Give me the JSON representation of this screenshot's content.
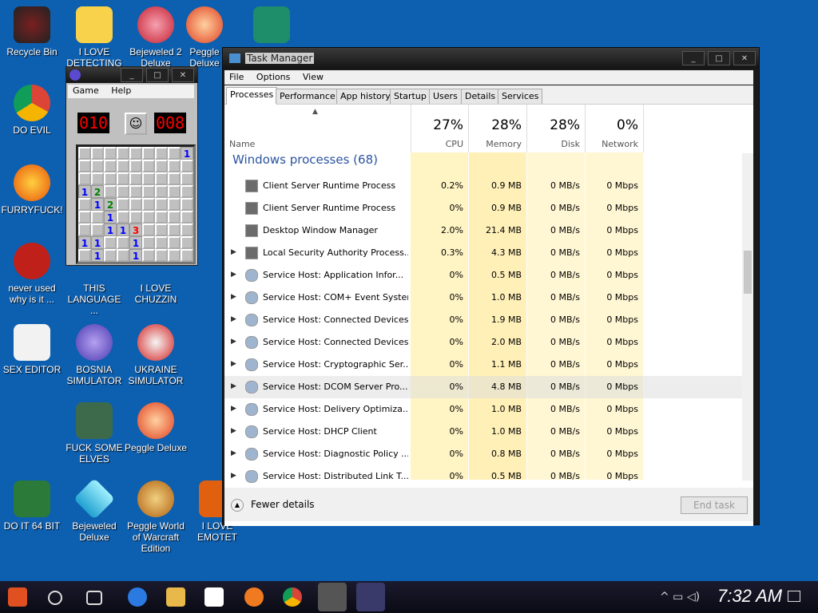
{
  "desktop": {
    "icons": [
      {
        "label": "Recycle Bin"
      },
      {
        "label": "I LOVE DETECTING"
      },
      {
        "label": "Bejeweled 2 Deluxe"
      },
      {
        "label": "Peggle Deluxe"
      },
      {
        "label": "DO EVIL"
      },
      {
        "label": "FURRYFUCK!"
      },
      {
        "label": "never used why is it ..."
      },
      {
        "label": "THIS LANGUAGE ..."
      },
      {
        "label": "I LOVE CHUZZIN"
      },
      {
        "label": "SEX EDITOR"
      },
      {
        "label": "BOSNIA SIMULATOR"
      },
      {
        "label": "UKRAINE SIMULATOR"
      },
      {
        "label": "FUCK SOME ELVES"
      },
      {
        "label": "Peggle Deluxe"
      },
      {
        "label": "DO IT 64 BIT"
      },
      {
        "label": "Bejeweled Deluxe"
      },
      {
        "label": "Peggle World of Warcraft Edition"
      },
      {
        "label": "I LOVE EMOTET"
      }
    ]
  },
  "minesweeper": {
    "menu": [
      "Game",
      "Help"
    ],
    "mines_counter": "010",
    "timer": "008",
    "face": "☺",
    "grid": [
      [
        "",
        "",
        "",
        "",
        "",
        "",
        "",
        "",
        "1"
      ],
      [
        "",
        "",
        "",
        "",
        "",
        "",
        "",
        "",
        ""
      ],
      [
        "",
        "",
        "",
        "",
        "",
        "",
        "",
        "",
        ""
      ],
      [
        "1",
        "2",
        "",
        "",
        "",
        "",
        "",
        "",
        ""
      ],
      [
        "",
        "1",
        "2",
        "",
        "",
        "",
        "",
        "",
        ""
      ],
      [
        "",
        "",
        "1",
        "",
        "",
        "",
        "",
        "",
        ""
      ],
      [
        "",
        "",
        "1",
        "1",
        "3",
        "",
        "",
        "",
        ""
      ],
      [
        "1",
        "1",
        "",
        "",
        "1",
        "",
        "",
        "",
        ""
      ],
      [
        "",
        "1",
        "",
        "",
        "1",
        "",
        "",
        "",
        ""
      ]
    ]
  },
  "taskmanager": {
    "title": "Task Manager",
    "menu": [
      "File",
      "Options",
      "View"
    ],
    "tabs": [
      "Processes",
      "Performance",
      "App history",
      "Startup",
      "Users",
      "Details",
      "Services"
    ],
    "columns": {
      "name": "Name",
      "cpu": {
        "pct": "27%",
        "label": "CPU"
      },
      "memory": {
        "pct": "28%",
        "label": "Memory"
      },
      "disk": {
        "pct": "28%",
        "label": "Disk"
      },
      "network": {
        "pct": "0%",
        "label": "Network"
      }
    },
    "group": "Windows processes (68)",
    "rows": [
      {
        "name": "Client Server Runtime Process",
        "cpu": "0.2%",
        "mem": "0.9 MB",
        "disk": "0 MB/s",
        "net": "0 Mbps",
        "exp": false,
        "gear": false
      },
      {
        "name": "Client Server Runtime Process",
        "cpu": "0%",
        "mem": "0.9 MB",
        "disk": "0 MB/s",
        "net": "0 Mbps",
        "exp": false,
        "gear": false
      },
      {
        "name": "Desktop Window Manager",
        "cpu": "2.0%",
        "mem": "21.4 MB",
        "disk": "0 MB/s",
        "net": "0 Mbps",
        "exp": false,
        "gear": false
      },
      {
        "name": "Local Security Authority Process...",
        "cpu": "0.3%",
        "mem": "4.3 MB",
        "disk": "0 MB/s",
        "net": "0 Mbps",
        "exp": true,
        "gear": false
      },
      {
        "name": "Service Host: Application Infor...",
        "cpu": "0%",
        "mem": "0.5 MB",
        "disk": "0 MB/s",
        "net": "0 Mbps",
        "exp": true,
        "gear": true
      },
      {
        "name": "Service Host: COM+ Event System",
        "cpu": "0%",
        "mem": "1.0 MB",
        "disk": "0 MB/s",
        "net": "0 Mbps",
        "exp": true,
        "gear": true
      },
      {
        "name": "Service Host: Connected Devices...",
        "cpu": "0%",
        "mem": "1.9 MB",
        "disk": "0 MB/s",
        "net": "0 Mbps",
        "exp": true,
        "gear": true
      },
      {
        "name": "Service Host: Connected Devices...",
        "cpu": "0%",
        "mem": "2.0 MB",
        "disk": "0 MB/s",
        "net": "0 Mbps",
        "exp": true,
        "gear": true
      },
      {
        "name": "Service Host: Cryptographic Ser...",
        "cpu": "0%",
        "mem": "1.1 MB",
        "disk": "0 MB/s",
        "net": "0 Mbps",
        "exp": true,
        "gear": true
      },
      {
        "name": "Service Host: DCOM Server Pro...",
        "cpu": "0%",
        "mem": "4.8 MB",
        "disk": "0 MB/s",
        "net": "0 Mbps",
        "exp": true,
        "gear": true
      },
      {
        "name": "Service Host: Delivery Optimiza...",
        "cpu": "0%",
        "mem": "1.0 MB",
        "disk": "0 MB/s",
        "net": "0 Mbps",
        "exp": true,
        "gear": true
      },
      {
        "name": "Service Host: DHCP Client",
        "cpu": "0%",
        "mem": "1.0 MB",
        "disk": "0 MB/s",
        "net": "0 Mbps",
        "exp": true,
        "gear": true
      },
      {
        "name": "Service Host: Diagnostic Policy ...",
        "cpu": "0%",
        "mem": "0.8 MB",
        "disk": "0 MB/s",
        "net": "0 Mbps",
        "exp": true,
        "gear": true
      },
      {
        "name": "Service Host: Distributed Link T...",
        "cpu": "0%",
        "mem": "0.5 MB",
        "disk": "0 MB/s",
        "net": "0 Mbps",
        "exp": true,
        "gear": true
      }
    ],
    "fewer_details": "Fewer details",
    "end_task": "End task"
  },
  "taskbar": {
    "clock": "7:32 AM"
  }
}
